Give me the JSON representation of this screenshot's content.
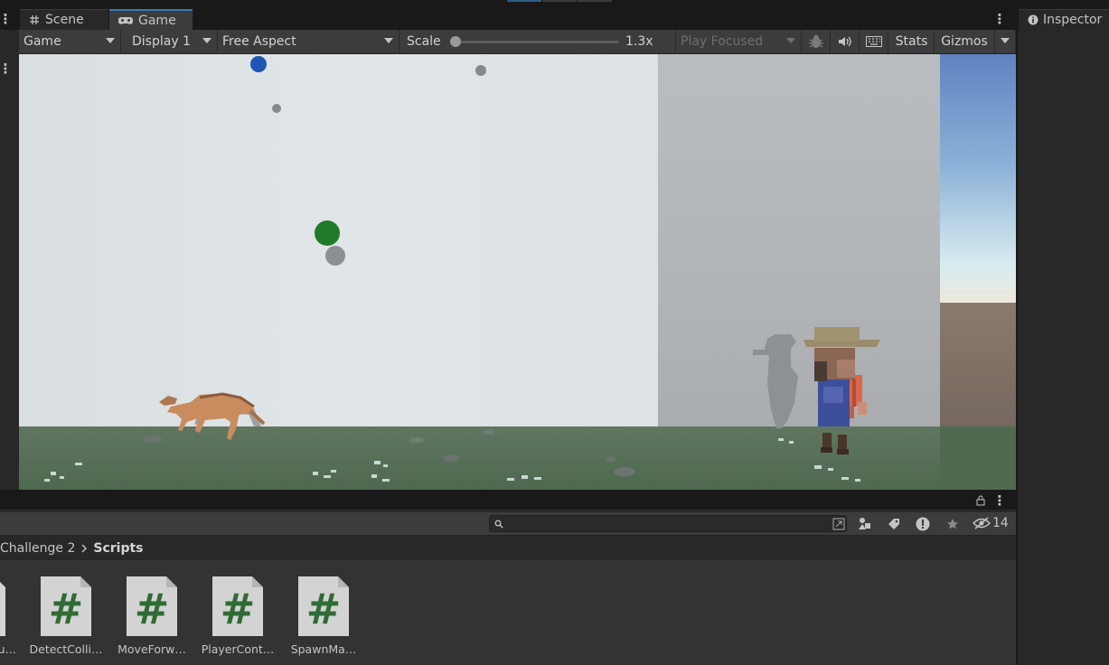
{
  "tabs": {
    "scene_label": "Scene",
    "game_label": "Game"
  },
  "game_toolbar": {
    "game_dropdown": "Game",
    "display_dropdown": "Display 1",
    "aspect_dropdown": "Free Aspect",
    "scale_label": "Scale",
    "scale_value": "1.3x",
    "scale_level": 0.0,
    "play_mode_dropdown": "Play Focused",
    "stats_label": "Stats",
    "gizmos_label": "Gizmos"
  },
  "inspector": {
    "tab_label": "Inspector"
  },
  "project": {
    "search_value": "",
    "hidden_count": "14",
    "breadcrumb": {
      "parent": "Challenge 2",
      "current": "Scripts"
    },
    "assets": [
      {
        "label": "DetectColli…",
        "icon": "csharp-script-icon"
      },
      {
        "label": "MoveForw…",
        "icon": "csharp-script-icon"
      },
      {
        "label": "PlayerCont…",
        "icon": "csharp-script-icon"
      },
      {
        "label": "SpawnMa…",
        "icon": "csharp-script-icon"
      }
    ],
    "partial_asset_label": "u…"
  },
  "colors": {
    "accent": "#3a79bb",
    "script_green": "#2f6b34",
    "panel": "#282828",
    "toolbar": "#3c3c3c"
  }
}
